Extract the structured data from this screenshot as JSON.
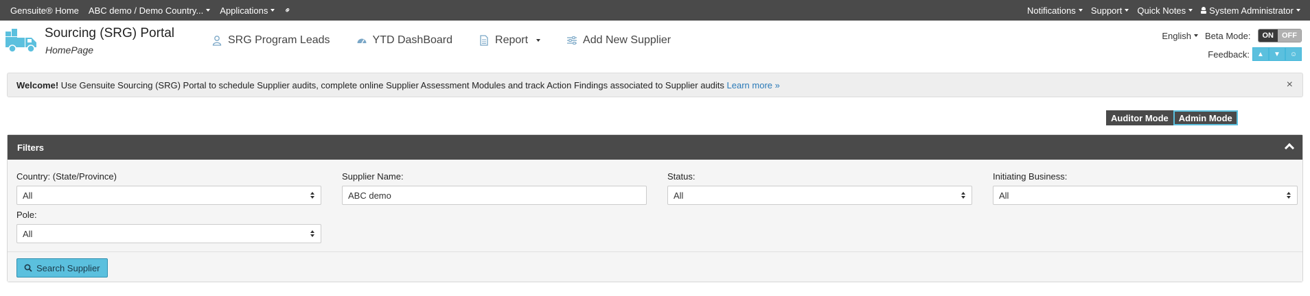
{
  "topbar": {
    "home": "Gensuite® Home",
    "site": "ABC demo / Demo Country...",
    "applications": "Applications",
    "notifications": "Notifications",
    "support": "Support",
    "quick_notes": "Quick Notes",
    "user": "System Administrator"
  },
  "header": {
    "title": "Sourcing (SRG) Portal",
    "subtitle": "HomePage",
    "nav": {
      "program_leads": "SRG Program Leads",
      "ytd_dashboard": "YTD DashBoard",
      "report": "Report",
      "add_supplier": "Add New Supplier"
    },
    "language": "English",
    "beta_mode_label": "Beta Mode:",
    "beta_on": "ON",
    "beta_off": "OFF",
    "feedback_label": "Feedback:"
  },
  "alert": {
    "strong": "Welcome!",
    "text": " Use Gensuite Sourcing (SRG) Portal to schedule Supplier audits, complete online Supplier Assessment Modules and track Action Findings associated to Supplier audits ",
    "link": "Learn more »",
    "close": "×"
  },
  "modes": {
    "auditor": "Auditor Mode",
    "admin": "Admin Mode"
  },
  "filters": {
    "title": "Filters",
    "country": {
      "label": "Country: (State/Province)",
      "value": "All"
    },
    "supplier": {
      "label": "Supplier Name:",
      "value": "ABC demo"
    },
    "status": {
      "label": "Status:",
      "value": "All"
    },
    "business": {
      "label": "Initiating Business:",
      "value": "All"
    },
    "pole": {
      "label": "Pole:",
      "value": "All"
    },
    "search_button": "Search Supplier"
  },
  "colors": {
    "topbar": "#4a4a4a",
    "accent": "#5bc0de",
    "link": "#2a7ab8"
  }
}
